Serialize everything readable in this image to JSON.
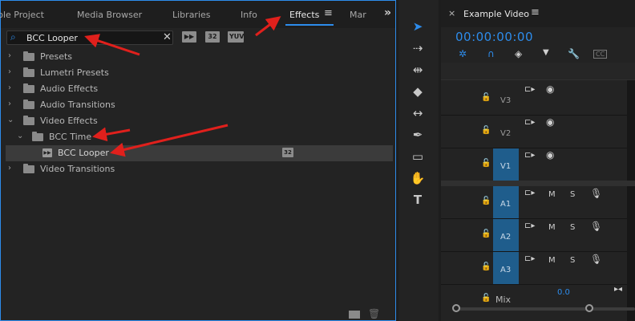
{
  "effects_panel": {
    "tabs": [
      {
        "label": "ble Project",
        "active": false
      },
      {
        "label": "Media Browser",
        "active": false
      },
      {
        "label": "Libraries",
        "active": false
      },
      {
        "label": "Info",
        "active": false
      },
      {
        "label": "Effects",
        "active": true
      },
      {
        "label": "Mar",
        "active": false
      }
    ],
    "menu_icon": "hamburger-menu-icon",
    "overflow_icon": "»",
    "search": {
      "value": "BCC Looper",
      "icon": "search-icon",
      "clear": "✕"
    },
    "filter_badges": [
      "32",
      "YUV"
    ],
    "tree": [
      {
        "label": "Presets",
        "expanded": false,
        "level": 0,
        "icon": "preset-folder-icon"
      },
      {
        "label": "Lumetri Presets",
        "expanded": false,
        "level": 0,
        "icon": "preset-folder-icon"
      },
      {
        "label": "Audio Effects",
        "expanded": false,
        "level": 0,
        "icon": "folder-icon"
      },
      {
        "label": "Audio Transitions",
        "expanded": false,
        "level": 0,
        "icon": "folder-icon"
      },
      {
        "label": "Video Effects",
        "expanded": true,
        "level": 0,
        "icon": "folder-icon"
      },
      {
        "label": "BCC Time",
        "expanded": true,
        "level": 1,
        "icon": "folder-icon"
      },
      {
        "label": "BCC Looper",
        "expanded": false,
        "level": 2,
        "icon": "effect-icon",
        "selected": true,
        "badge": "32"
      },
      {
        "label": "Video Transitions",
        "expanded": false,
        "level": 0,
        "icon": "folder-icon"
      }
    ]
  },
  "timeline": {
    "title": "Example Video",
    "close": "×",
    "timecode": "00:00:00:00",
    "video_tracks": [
      {
        "name": "V3",
        "targeted": false
      },
      {
        "name": "V2",
        "targeted": false
      },
      {
        "name": "V1",
        "targeted": true
      }
    ],
    "audio_tracks": [
      {
        "name": "A1",
        "targeted": true,
        "m": "M",
        "s": "S"
      },
      {
        "name": "A2",
        "targeted": true,
        "m": "M",
        "s": "S"
      },
      {
        "name": "A3",
        "targeted": true,
        "m": "M",
        "s": "S"
      }
    ],
    "mix": {
      "label": "Mix",
      "value": "0.0"
    }
  },
  "colors": {
    "accent": "#2d8ceb",
    "arrow": "#e0201c",
    "panel_bg": "#232323",
    "track_target": "#1f5d8c"
  }
}
